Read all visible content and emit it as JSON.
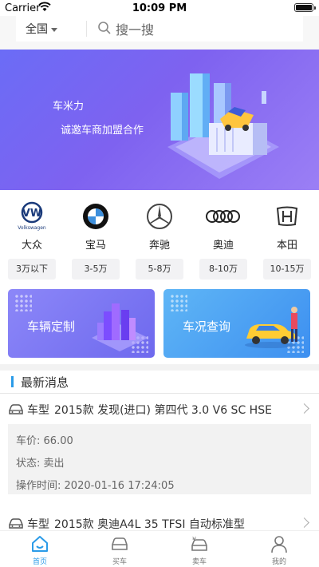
{
  "status_bar": {
    "carrier": "Carrier",
    "time": "10:09 PM"
  },
  "search": {
    "region": "全国",
    "placeholder": "搜一搜"
  },
  "banner": {
    "line1": "车米力",
    "line2": "诚邀车商加盟合作"
  },
  "brands": [
    {
      "name": "大众",
      "logo_text": "Volkswagen",
      "icon": "volkswagen-logo"
    },
    {
      "name": "宝马",
      "icon": "bmw-logo"
    },
    {
      "name": "奔驰",
      "icon": "mercedes-logo"
    },
    {
      "name": "奥迪",
      "icon": "audi-logo"
    },
    {
      "name": "本田",
      "icon": "honda-logo"
    }
  ],
  "price_ranges": [
    "3万以下",
    "3-5万",
    "5-8万",
    "8-10万",
    "10-15万"
  ],
  "features": [
    {
      "label": "车辆定制",
      "icon": "city-illustration"
    },
    {
      "label": "车况查询",
      "icon": "car-inspection-illustration"
    }
  ],
  "news": {
    "section_title": "最新消息",
    "items": [
      {
        "prefix": "车型",
        "model": "2015款 发现(进口) 第四代 3.0 V6 SC HSE",
        "price_label": "车价:",
        "price": "66.00",
        "status_label": "状态:",
        "status": "卖出",
        "time_label": "操作时间:",
        "time": "2020-01-16 17:24:05"
      },
      {
        "prefix": "车型",
        "model": "2015款 奥迪A4L 35 TFSI 自动标准型"
      }
    ]
  },
  "tabbar": [
    {
      "label": "首页",
      "icon": "home-icon",
      "active": true
    },
    {
      "label": "买车",
      "icon": "car-icon"
    },
    {
      "label": "卖车",
      "icon": "sell-car-icon"
    },
    {
      "label": "我的",
      "icon": "user-icon"
    }
  ],
  "colors": {
    "accent": "#2b9be8",
    "banner": "#7a67f2",
    "feature_left": "#7d78f3",
    "feature_right": "#4a9cf2"
  }
}
